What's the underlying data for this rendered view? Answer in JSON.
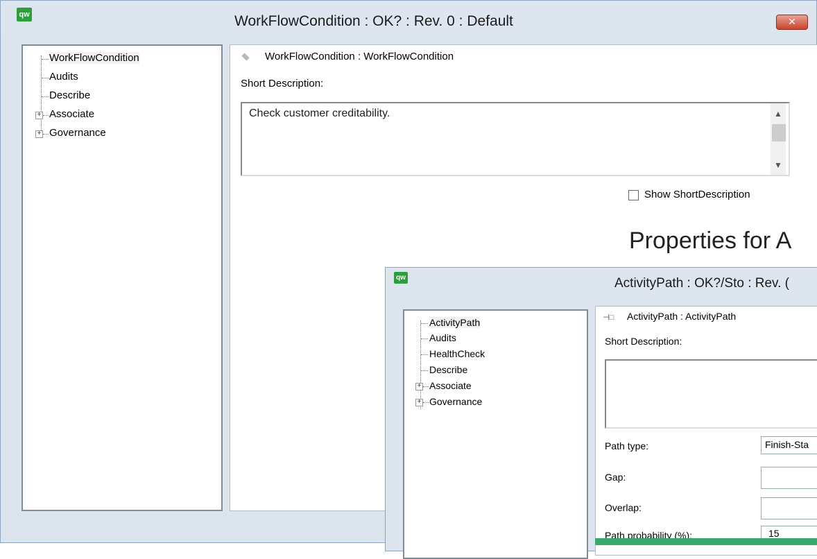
{
  "window1": {
    "title": "WorkFlowCondition : OK? : Rev. 0  : Default",
    "logo_text": "qw",
    "close_label": "✕",
    "tree": [
      "WorkFlowCondition",
      "Audits",
      "Describe",
      "Associate",
      "Governance"
    ],
    "header": "WorkFlowCondition : WorkFlowCondition",
    "short_desc_label": "Short Description:",
    "short_desc_value": "Check customer creditability.",
    "show_short_desc_label": "Show ShortDescription"
  },
  "overlay_heading": "Properties for A",
  "window2": {
    "title": "ActivityPath : OK?/Sto : Rev. (",
    "logo_text": "qw",
    "tree": [
      "ActivityPath",
      "Audits",
      "HealthCheck",
      "Describe",
      "Associate",
      "Governance"
    ],
    "header": "ActivityPath : ActivityPath",
    "short_desc_label": "Short Description:",
    "fields": [
      {
        "label": "Path type:",
        "value": "Finish-Sta"
      },
      {
        "label": "Gap:",
        "value": ""
      },
      {
        "label": "Overlap:",
        "value": ""
      },
      {
        "label": "Path probability (%):",
        "value": "15"
      }
    ]
  },
  "colors": {
    "logo": "#2e9e3a",
    "close": "#c8452f",
    "window_bg": "#dce5ee"
  }
}
